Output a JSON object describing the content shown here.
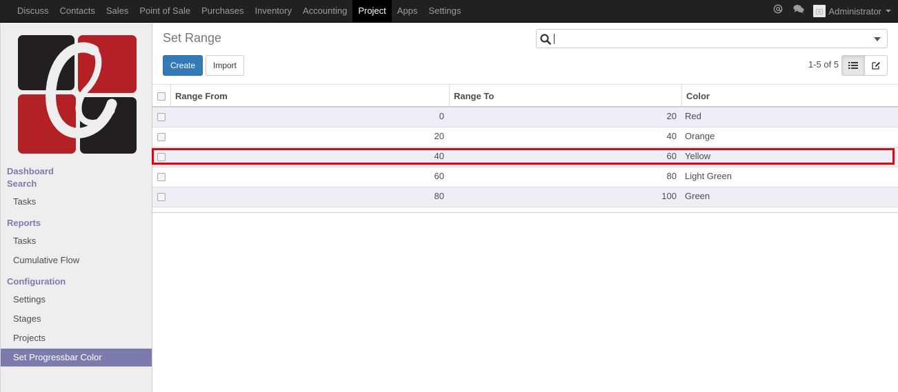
{
  "menu": {
    "items": [
      {
        "label": "Discuss"
      },
      {
        "label": "Contacts"
      },
      {
        "label": "Sales"
      },
      {
        "label": "Point of Sale"
      },
      {
        "label": "Purchases"
      },
      {
        "label": "Inventory"
      },
      {
        "label": "Accounting"
      },
      {
        "label": "Project",
        "active": true
      },
      {
        "label": "Apps"
      },
      {
        "label": "Settings"
      }
    ]
  },
  "user": {
    "name": "Administrator"
  },
  "icons": {
    "mention": "at-icon",
    "chat": "chat-bubbles-icon",
    "search": "search-icon",
    "list_view": "list-view-icon",
    "form_view": "edit-form-icon"
  },
  "sidebar": {
    "sections": [
      {
        "title": "Dashboard",
        "items": []
      },
      {
        "title": "Search",
        "items": [
          "Tasks"
        ]
      },
      {
        "title": "Reports",
        "items": [
          "Tasks",
          "Cumulative Flow"
        ]
      },
      {
        "title": "Configuration",
        "items": [
          "Settings",
          "Stages",
          "Projects",
          "Set Progressbar Color"
        ]
      }
    ],
    "active_item": "Set Progressbar Color"
  },
  "control_panel": {
    "title": "Set Range",
    "create_label": "Create",
    "import_label": "Import",
    "pager": "1-5 of 5",
    "search_value": ""
  },
  "table": {
    "columns": [
      "Range From",
      "Range To",
      "Color"
    ],
    "rows": [
      {
        "from": "0",
        "to": "20",
        "color": "Red"
      },
      {
        "from": "20",
        "to": "40",
        "color": "Orange"
      },
      {
        "from": "40",
        "to": "60",
        "color": "Yellow"
      },
      {
        "from": "60",
        "to": "80",
        "color": "Light Green"
      },
      {
        "from": "80",
        "to": "100",
        "color": "Green"
      }
    ],
    "highlighted_row": 2
  },
  "colors": {
    "navbar": "#212121",
    "accent": "#7c7bad",
    "primary_button": "#337ab7",
    "highlight_border": "#e8000b",
    "logo_red": "#b32127",
    "logo_dark": "#231f20"
  }
}
